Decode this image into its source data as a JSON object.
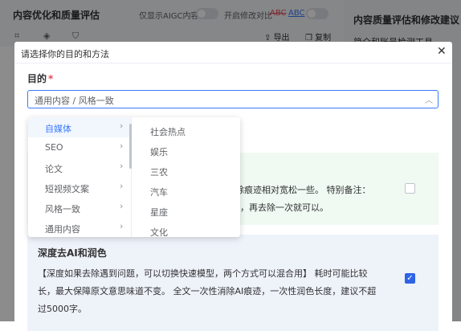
{
  "background": {
    "title": "内容优化和质量评估",
    "aigc_toggle_label": "仅显示AIGC内容",
    "compare_toggle_label": "开启修改对比",
    "abc_old": "ABC",
    "abc_new": "ABC",
    "export_label": "导出",
    "copy_label": "复制",
    "right_panel_title": "内容质量评估和修改建议",
    "right_panel_sub": "简介和账号检测工具"
  },
  "modal": {
    "title": "请选择你的目的和方法",
    "close_icon": "close-icon",
    "field_label": "目的",
    "required_mark": "*",
    "select_value": "通用内容 / 风格一致",
    "card1": {
      "line1": "去除痕迹相对宽松一些。 特别备注：",
      "line2": "入，再去除一次就可以。",
      "checked": false
    },
    "card2": {
      "title": "深度去AI和润色",
      "line1": "【深度如果去除遇到问题，可以切换快速模型，两个方式可以混合用】 耗时可能比较",
      "line2": "长，最大保障原文意思味道不变。 全文一次性消除AI痕迹，一次性润色长度，建议不超",
      "line3": "过5000字。",
      "checked": true
    }
  },
  "cascader": {
    "level1": [
      {
        "label": "自媒体",
        "active": true
      },
      {
        "label": "SEO"
      },
      {
        "label": "论文"
      },
      {
        "label": "短视频文案"
      },
      {
        "label": "风格一致"
      },
      {
        "label": "通用内容"
      }
    ],
    "level2": [
      "社会热点",
      "娱乐",
      "三农",
      "汽车",
      "星座",
      "文化"
    ]
  },
  "colors": {
    "accent": "#3a7afe",
    "required": "#e34d59",
    "checkbox": "#2e63e6"
  }
}
